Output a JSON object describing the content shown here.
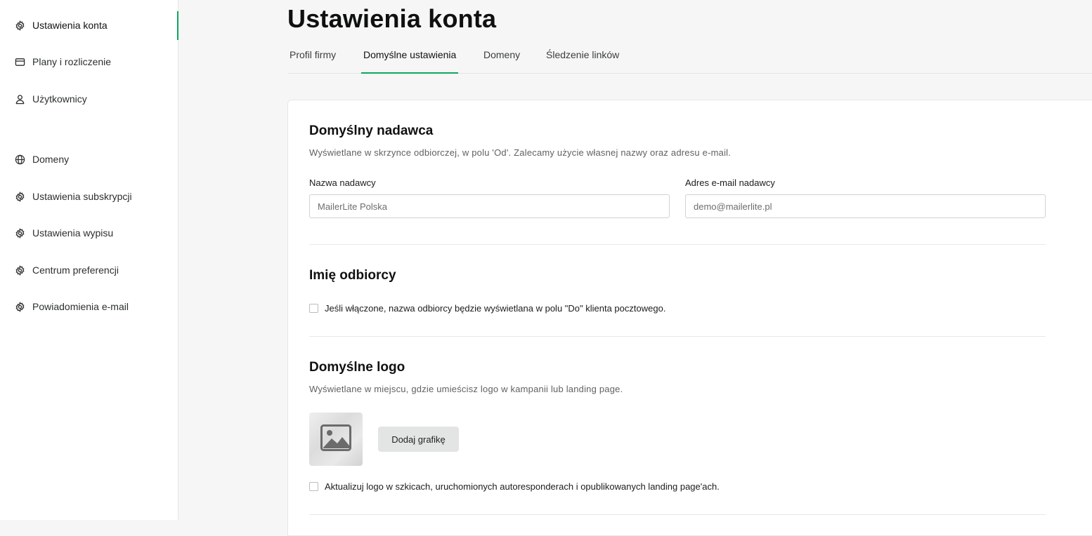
{
  "sidebar": {
    "items": [
      {
        "label": "Ustawienia konta",
        "icon": "gear-icon"
      },
      {
        "label": "Plany i rozliczenie",
        "icon": "card-icon"
      },
      {
        "label": "Użytkownicy",
        "icon": "user-icon"
      },
      {
        "label": "Domeny",
        "icon": "globe-icon"
      },
      {
        "label": "Ustawienia subskrypcji",
        "icon": "gear-icon"
      },
      {
        "label": "Ustawienia wypisu",
        "icon": "gear-icon"
      },
      {
        "label": "Centrum preferencji",
        "icon": "gear-icon"
      },
      {
        "label": "Powiadomienia e-mail",
        "icon": "gear-icon"
      }
    ],
    "active_index": 0
  },
  "page": {
    "title": "Ustawienia konta"
  },
  "tabs": [
    {
      "label": "Profil firmy"
    },
    {
      "label": "Domyślne ustawienia",
      "active": true
    },
    {
      "label": "Domeny"
    },
    {
      "label": "Śledzenie linków"
    }
  ],
  "sender": {
    "heading": "Domyślny nadawca",
    "description": "Wyświetlane w skrzynce odbiorczej, w polu 'Od'. Zalecamy użycie własnej nazwy oraz adresu e-mail.",
    "name_label": "Nazwa nadawcy",
    "name_value": "MailerLite Polska",
    "email_label": "Adres e-mail nadawcy",
    "email_value": "demo@mailerlite.pl"
  },
  "recipient": {
    "heading": "Imię odbiorcy",
    "checkbox_label": "Jeśli włączone, nazwa odbiorcy będzie wyświetlana w polu \"Do\" klienta pocztowego.",
    "checked": false
  },
  "logo": {
    "heading": "Domyślne logo",
    "description": "Wyświetlane w miejscu, gdzie umieścisz logo w kampanii lub landing page.",
    "placeholder_icon": "image-icon",
    "add_button": "Dodaj grafikę",
    "update_checkbox_label": "Aktualizuj logo w szkicach, uruchomionych autoresponderach i opublikowanych landing page'ach.",
    "update_checked": false
  },
  "colors": {
    "accent": "#09a85d",
    "background": "#f5f6f5"
  }
}
